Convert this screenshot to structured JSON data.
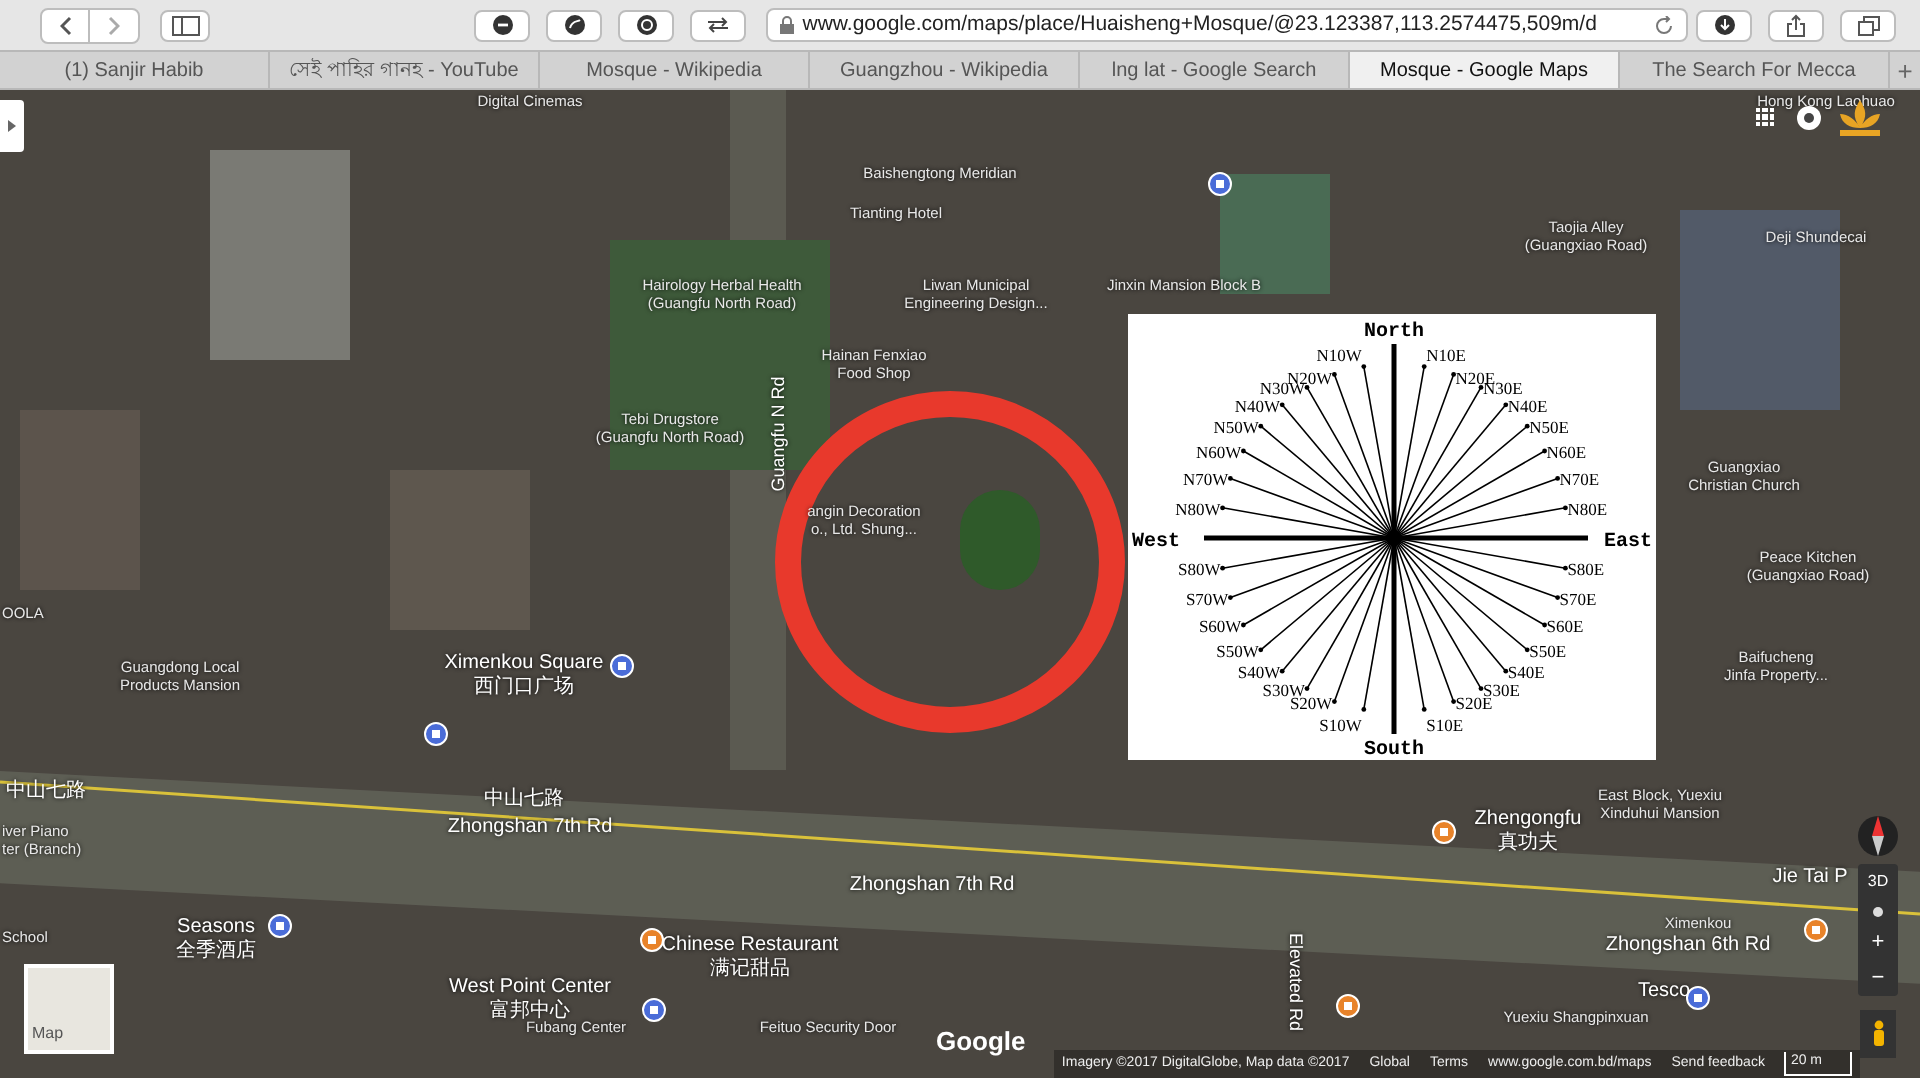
{
  "browser": {
    "url": "www.google.com/maps/place/Huaisheng+Mosque/@23.123387,113.2574475,509m/d",
    "tabs": [
      {
        "label": "(1) Sanjir Habib",
        "selected": false
      },
      {
        "label": "সেই পাহির গানহ - YouTube",
        "selected": false
      },
      {
        "label": "Mosque - Wikipedia",
        "selected": false
      },
      {
        "label": "Guangzhou - Wikipedia",
        "selected": false
      },
      {
        "label": "lng lat - Google Search",
        "selected": false
      },
      {
        "label": "Mosque - Google Maps",
        "selected": true
      },
      {
        "label": "The Search For Mecca",
        "selected": false
      }
    ],
    "new_tab": "+"
  },
  "map": {
    "labels": [
      {
        "kind": "place",
        "lines": [
          "Digital Cinemas"
        ]
      },
      {
        "kind": "place",
        "lines": [
          "Hong Kong Laohuao"
        ]
      },
      {
        "kind": "place",
        "lines": [
          "Baishengtong Meridian"
        ]
      },
      {
        "kind": "place",
        "lines": [
          "Tianting Hotel"
        ]
      },
      {
        "kind": "place",
        "lines": [
          "Taojia Alley",
          "(Guangxiao Road)"
        ]
      },
      {
        "kind": "place",
        "lines": [
          "Deji Shundecai"
        ]
      },
      {
        "kind": "place",
        "lines": [
          "Hairology Herbal Health",
          "(Guangfu North Road)"
        ]
      },
      {
        "kind": "place",
        "lines": [
          "Liwan Municipal",
          "Engineering Design..."
        ]
      },
      {
        "kind": "place",
        "lines": [
          "Jinxin Mansion Block B"
        ]
      },
      {
        "kind": "place",
        "lines": [
          "Hainan Fenxiao",
          "Food Shop"
        ]
      },
      {
        "kind": "place",
        "lines": [
          "Tebi Drugstore",
          "(Guangfu North Road)"
        ]
      },
      {
        "kind": "road-vertical",
        "lines": [
          "Guangfu N Rd"
        ]
      },
      {
        "kind": "place",
        "lines": [
          "Guangxiao",
          "Christian Church"
        ]
      },
      {
        "kind": "place",
        "lines": [
          "angin Decoration",
          "o., Ltd. Shung..."
        ]
      },
      {
        "kind": "place",
        "lines": [
          "Peace Kitchen",
          "(Guangxiao Road)"
        ]
      },
      {
        "kind": "place",
        "lines": [
          "OOLA"
        ]
      },
      {
        "kind": "place",
        "lines": [
          "Guangdong Local",
          "Products Mansion"
        ]
      },
      {
        "kind": "major",
        "lines": [
          "Ximenkou Square",
          "西门口广场"
        ]
      },
      {
        "kind": "place",
        "lines": [
          "Baifucheng",
          "Jinfa Property..."
        ]
      },
      {
        "kind": "road",
        "lines": [
          "中山七路"
        ]
      },
      {
        "kind": "road",
        "lines": [
          "中山七路"
        ]
      },
      {
        "kind": "place",
        "lines": [
          "iver Piano",
          "ter (Branch)"
        ]
      },
      {
        "kind": "road",
        "lines": [
          "Zhongshan 7th Rd"
        ]
      },
      {
        "kind": "major",
        "lines": [
          "Zhengongfu",
          "真功夫"
        ]
      },
      {
        "kind": "place",
        "lines": [
          "East Block, Yuexiu",
          "Xinduhui Mansion"
        ]
      },
      {
        "kind": "major",
        "lines": [
          "Jie Tai P"
        ]
      },
      {
        "kind": "road",
        "lines": [
          "Zhongshan 7th Rd"
        ]
      },
      {
        "kind": "major",
        "lines": [
          "Seasons",
          "全季酒店"
        ]
      },
      {
        "kind": "place",
        "lines": [
          "Ximenkou"
        ]
      },
      {
        "kind": "place",
        "lines": [
          "School"
        ]
      },
      {
        "kind": "major",
        "lines": [
          "Chinese Restaurant",
          "满记甜品"
        ]
      },
      {
        "kind": "road",
        "lines": [
          "Zhongshan 6th Rd"
        ]
      },
      {
        "kind": "major",
        "lines": [
          "West Point Center",
          "富邦中心"
        ]
      },
      {
        "kind": "major",
        "lines": [
          "Tesco"
        ]
      },
      {
        "kind": "road-vertical-down",
        "lines": [
          "Elevated Rd"
        ]
      },
      {
        "kind": "place",
        "lines": [
          "Yuexiu Shangpinxuan"
        ]
      },
      {
        "kind": "place",
        "lines": [
          "Fubang Center"
        ]
      },
      {
        "kind": "place",
        "lines": [
          "Feituo Security Door"
        ]
      }
    ],
    "compass": {
      "cardinals": [
        "North",
        "West",
        "East",
        "South"
      ],
      "west": [
        "N10W",
        "N20W",
        "N30W",
        "N40W",
        "N50W",
        "N60W",
        "N70W",
        "N80W",
        "S80W",
        "S70W",
        "S60W",
        "S50W",
        "S40W",
        "S30W",
        "S20W",
        "S10W"
      ],
      "east": [
        "N10E",
        "N20E",
        "N30E",
        "N40E",
        "N50E",
        "N60E",
        "N70E",
        "N80E",
        "S80E",
        "S70E",
        "S60E",
        "S50E",
        "S40E",
        "S30E",
        "S20E",
        "S10E"
      ]
    },
    "thumbnail_label": "Map",
    "view_3d": "3D",
    "zoom_in": "+",
    "zoom_out": "−",
    "logo": "Google",
    "footer": [
      "Imagery ©2017 DigitalGlobe, Map data ©2017",
      "Global",
      "Terms",
      "www.google.com.bd/maps",
      "Send feedback",
      "20 m"
    ]
  }
}
